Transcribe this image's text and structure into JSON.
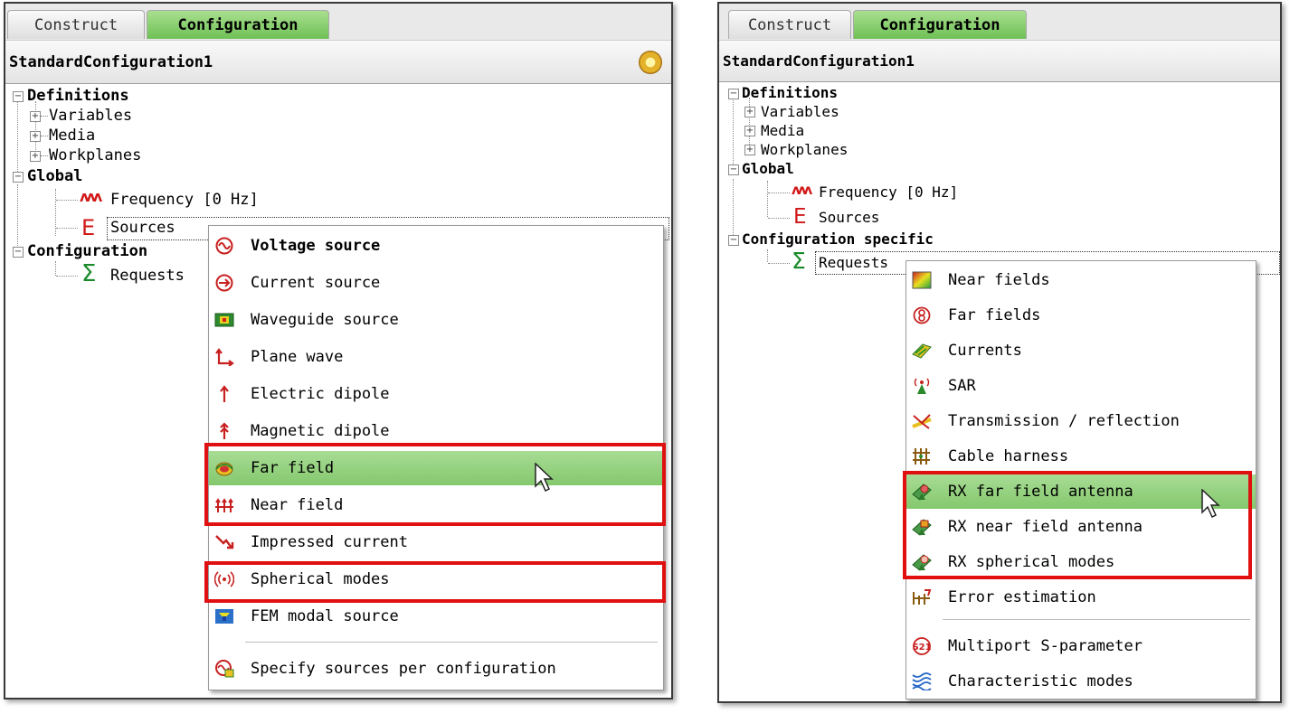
{
  "left": {
    "tabs": {
      "construct": "Construct",
      "configuration": "Configuration"
    },
    "config_name": "StandardConfiguration1",
    "tree": {
      "definitions": "Definitions",
      "variables": "Variables",
      "media": "Media",
      "workplanes": "Workplanes",
      "global": "Global",
      "frequency": "Frequency [0 Hz]",
      "sources": "Sources",
      "configuration": "Configuration",
      "requests": "Requests"
    },
    "menu": [
      {
        "label": "Voltage source",
        "icon": "voltage-source-icon"
      },
      {
        "label": "Current source",
        "icon": "current-source-icon"
      },
      {
        "label": "Waveguide source",
        "icon": "waveguide-source-icon"
      },
      {
        "label": "Plane wave",
        "icon": "plane-wave-icon"
      },
      {
        "label": "Electric dipole",
        "icon": "electric-dipole-icon"
      },
      {
        "label": "Magnetic dipole",
        "icon": "magnetic-dipole-icon"
      },
      {
        "label": "Far field",
        "icon": "far-field-icon"
      },
      {
        "label": "Near field",
        "icon": "near-field-icon"
      },
      {
        "label": "Impressed current",
        "icon": "impressed-current-icon"
      },
      {
        "label": "Spherical modes",
        "icon": "spherical-modes-icon"
      },
      {
        "label": "FEM modal source",
        "icon": "fem-modal-source-icon"
      },
      {
        "label": "Specify sources per configuration",
        "icon": "specify-sources-icon"
      }
    ]
  },
  "right": {
    "tabs": {
      "construct": "Construct",
      "configuration": "Configuration"
    },
    "config_name": "StandardConfiguration1",
    "tree": {
      "definitions": "Definitions",
      "variables": "Variables",
      "media": "Media",
      "workplanes": "Workplanes",
      "global": "Global",
      "frequency": "Frequency [0 Hz]",
      "sources": "Sources",
      "configuration_specific": "Configuration specific",
      "requests": "Requests"
    },
    "menu": [
      {
        "label": "Near fields",
        "icon": "near-fields-icon"
      },
      {
        "label": "Far fields",
        "icon": "far-fields-icon"
      },
      {
        "label": "Currents",
        "icon": "currents-icon"
      },
      {
        "label": "SAR",
        "icon": "sar-icon"
      },
      {
        "label": "Transmission / reflection",
        "icon": "transmission-reflection-icon"
      },
      {
        "label": "Cable harness",
        "icon": "cable-harness-icon"
      },
      {
        "label": "RX far field antenna",
        "icon": "rx-far-field-antenna-icon"
      },
      {
        "label": "RX near field antenna",
        "icon": "rx-near-field-antenna-icon"
      },
      {
        "label": "RX spherical modes",
        "icon": "rx-spherical-modes-icon"
      },
      {
        "label": "Error estimation",
        "icon": "error-estimation-icon"
      },
      {
        "label": "Multiport S-parameter",
        "icon": "multiport-s-parameter-icon"
      },
      {
        "label": "Characteristic modes",
        "icon": "characteristic-modes-icon"
      }
    ]
  },
  "icon_glyphs": {
    "frequency": "ᴧᴧᴧ",
    "sources": "E",
    "requests": "Σ"
  }
}
